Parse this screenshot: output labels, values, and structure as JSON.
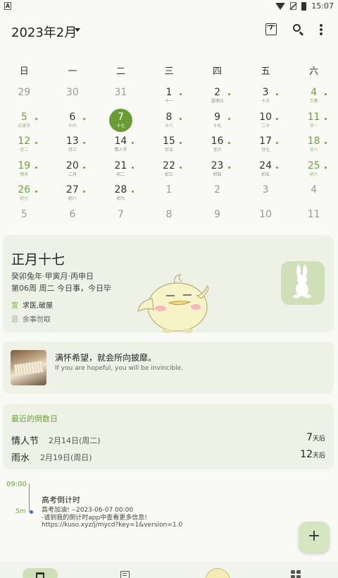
{
  "status_bar": {
    "time": "15:07",
    "left_icon": "A"
  },
  "header": {
    "month_title": "2023年2月",
    "today_button_day": "7"
  },
  "weekdays": [
    "日",
    "一",
    "二",
    "三",
    "四",
    "五",
    "六"
  ],
  "calendar": [
    [
      {
        "d": "29",
        "l": "",
        "kind": "other"
      },
      {
        "d": "30",
        "l": "",
        "kind": "other"
      },
      {
        "d": "31",
        "l": "",
        "kind": "other"
      },
      {
        "d": "1",
        "l": "十一",
        "kind": "normal",
        "dot": true
      },
      {
        "d": "2",
        "l": "湿地日",
        "kind": "normal",
        "dot": true
      },
      {
        "d": "3",
        "l": "十三",
        "kind": "normal",
        "dot": true
      },
      {
        "d": "4",
        "l": "立春",
        "kind": "weekend",
        "dot": true
      }
    ],
    [
      {
        "d": "5",
        "l": "元宵节",
        "kind": "weekend",
        "dot": true
      },
      {
        "d": "6",
        "l": "十六",
        "kind": "normal",
        "dot": true
      },
      {
        "d": "7",
        "l": "十七",
        "kind": "today",
        "dot": false
      },
      {
        "d": "8",
        "l": "十八",
        "kind": "normal",
        "dot": true
      },
      {
        "d": "9",
        "l": "十九",
        "kind": "normal",
        "dot": true
      },
      {
        "d": "10",
        "l": "二十",
        "kind": "normal",
        "dot": true
      },
      {
        "d": "11",
        "l": "廿一",
        "kind": "weekend",
        "dot": true
      }
    ],
    [
      {
        "d": "12",
        "l": "廿二",
        "kind": "weekend",
        "dot": true
      },
      {
        "d": "13",
        "l": "廿三",
        "kind": "normal",
        "dot": true
      },
      {
        "d": "14",
        "l": "情人节",
        "kind": "normal",
        "dot": true
      },
      {
        "d": "15",
        "l": "廿五",
        "kind": "normal",
        "dot": true
      },
      {
        "d": "16",
        "l": "廿六",
        "kind": "normal",
        "dot": true
      },
      {
        "d": "17",
        "l": "廿七",
        "kind": "normal",
        "dot": true
      },
      {
        "d": "18",
        "l": "廿八",
        "kind": "weekend",
        "dot": true
      }
    ],
    [
      {
        "d": "19",
        "l": "雨水",
        "kind": "weekend",
        "dot": true
      },
      {
        "d": "20",
        "l": "二月",
        "kind": "normal",
        "dot": true
      },
      {
        "d": "21",
        "l": "初二",
        "kind": "normal",
        "dot": true
      },
      {
        "d": "22",
        "l": "初三",
        "kind": "normal",
        "dot": true
      },
      {
        "d": "23",
        "l": "初四",
        "kind": "normal",
        "dot": true
      },
      {
        "d": "24",
        "l": "初五",
        "kind": "normal",
        "dot": true
      },
      {
        "d": "25",
        "l": "初六",
        "kind": "weekend",
        "dot": true
      }
    ],
    [
      {
        "d": "26",
        "l": "初七",
        "kind": "weekend",
        "dot": true
      },
      {
        "d": "27",
        "l": "初八",
        "kind": "normal",
        "dot": true
      },
      {
        "d": "28",
        "l": "初九",
        "kind": "normal",
        "dot": true
      },
      {
        "d": "1",
        "l": "",
        "kind": "other"
      },
      {
        "d": "2",
        "l": "",
        "kind": "other"
      },
      {
        "d": "3",
        "l": "",
        "kind": "other"
      },
      {
        "d": "4",
        "l": "",
        "kind": "other"
      }
    ],
    [
      {
        "d": "5",
        "l": "",
        "kind": "other"
      },
      {
        "d": "6",
        "l": "",
        "kind": "other"
      },
      {
        "d": "7",
        "l": "",
        "kind": "other"
      },
      {
        "d": "8",
        "l": "",
        "kind": "other"
      },
      {
        "d": "9",
        "l": "",
        "kind": "other"
      },
      {
        "d": "10",
        "l": "",
        "kind": "other"
      },
      {
        "d": "11",
        "l": "",
        "kind": "other"
      }
    ]
  ],
  "day_card": {
    "lunar_date": "正月十七",
    "ganzhi": "癸卯兔年·甲寅月·丙申日",
    "week_info": "第06周 周二 今日事，今日毕",
    "yi_label": "宜",
    "yi_text": "求医,破屋",
    "ji_label": "忌",
    "ji_text": "余事勿取"
  },
  "quote": {
    "zh": "满怀希望，就会所向披靡。",
    "en": "If you are hopeful, you will be invincible."
  },
  "countdown": {
    "heading": "最近的倒数日",
    "items": [
      {
        "name": "情人节",
        "date": "2月14日(周二)",
        "days": "7",
        "unit": "天后"
      },
      {
        "name": "雨水",
        "date": "2月19日(周日)",
        "days": "12",
        "unit": "天后"
      }
    ]
  },
  "schedule": {
    "time": "09:00",
    "duration": "5m",
    "title": "高考倒计时",
    "desc": "高考加油! --2023-06-07 00:00\n-请到我的倒计时app中查看更多信息!\nhttps://kuso.xyz/j/mycd?key=1&version=1.0"
  },
  "fab_label": "+",
  "colors": {
    "accent": "#6aa33a",
    "today": "#6a9c35",
    "card": "#eef2e6"
  }
}
